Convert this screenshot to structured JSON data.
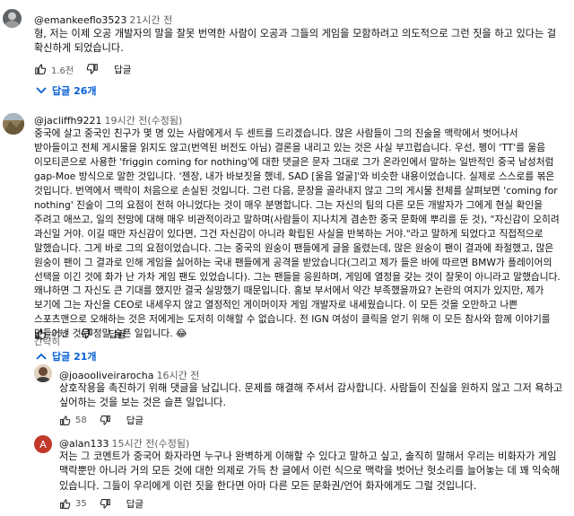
{
  "comments": [
    {
      "handle": "@emankeeflo3523",
      "time": "21시간 전",
      "text": "형, 저는 이제 오공 개발자의 말을 잘못 번역한 사람이 오공과 그들의 게임을 모함하려고 의도적으로 그런 짓을 하고 있다는 걸 확신하게 되었습니다.",
      "likes": "1.6천",
      "reply_label": "답글",
      "replies_label": "답글 26개"
    },
    {
      "handle": "@jacliffh9221",
      "time": "19시간 전(수정됨)",
      "text": "중국에 살고 중국인 친구가 몇 명 있는 사람에게서 두 센트를 드리겠습니다. 많은 사람들이 그의 진술을 맥락에서 벗어나서 받아들이고 전체 게시물을 읽지도 않고(번역된 버전도 아님) 결론을 내리고 있는 것은 사실 부끄럽습니다. 우선, 펭이 'TT'를 울음 이모티콘으로 사용한 'friggin coming for nothing'에 대한 댓글은 문자 그대로 그가 온라인에서 말하는 일반적인 중국 남성처럼 gap-Moe 방식으로 말한 것입니다. '젠장, 내가 바보짓을 했네, SAD [울음 얼굴]'와 비슷한 내용이었습니다. 실제로 스스로를 볶은 것입니다. 번역에서 맥락이 처음으로 손실된 것입니다. 그런 다음, 문장을 골라내지 않고 그의 게시물 전체를 살펴보면 'coming for nothing' 진술이 그의 요점이 전혀 아니었다는 것이 매우 분명합니다. 그는 자신의 팀의 다른 모든 개발자가 그에게 현실 확인을 주려고 애쓰고, 일의 전망에 대해 매우 비관적이라고 말하며(사람들이 지나치게 겸손한 중국 문화에 뿌리를 둔 것), \"자신감이 오히려 과신일 거야. 이길 때만 자신감이 있다면, 그건 자신감이 아니라 확립된 사실을 반복하는 거야.\"라고 말하게 되었다고 직접적으로 말했습니다. 그게 바로 그의 요점이었습니다. 그는 중국의 원숭이 팬들에게 글을 올렸는데, 많은 원숭이 팬이 결과에 좌절했고, 많은 원숭이 팬이 그 결과로 인해 게임을 싫어하는 국내 팬들에게 공격을 받았습니다(그리고 제가 들은 바에 따르면 BMW가 플레이어의 선택을 이긴 것에 화가 난 가차 게임 팬도 있었습니다). 그는 팬들을 응원하며, 게임에 열정을 갖는 것이 잘못이 아니라고 말했습니다. 왜냐하면 그 자신도 큰 기대를 했지만 결국 실망했기 때문입니다. 홍보 부서에서 약간 부족했을까요? 논란의 여지가 있지만, 제가 보기에 그는 자신을 CEO로 내세우지 않고 열정적인 게이머이자 게임 개발자로 내세웠습니다. 이 모든 것을 오만하고 나쁜 스포츠맨으로 오해하는 것은 저에게는 도저히 이해할 수 없습니다. 전 IGN 여성이 클릭을 얻기 위해 이 모든 참사와 함께 이야기를 만들어낸 것은 정말 슬픈 일입니다. 😂",
      "translate_label": "간략히",
      "likes": "855",
      "reply_label": "답글",
      "replies_label": "답글 21개"
    },
    {
      "handle": "@joaooliveirarocha",
      "time": "16시간 전",
      "text": "상호작용을 촉진하기 위해 댓글을 남깁니다. 문제를 해결해 주셔서 감사합니다. 사람들이 진실을 원하지 않고 그저 욕하고 싶어하는 것을 보는 것은 슬픈 일입니다.",
      "likes": "58",
      "reply_label": "답글"
    },
    {
      "handle": "@alan133",
      "time": "15시간 전(수정됨)",
      "avatar_letter": "A",
      "text": "저는 그 코멘트가 중국어 화자라면 누구나 완벽하게 이해할 수 있다고 말하고 싶고, 솔직히 말해서 우리는 비화자가 게임 맥락뿐만 아니라 거의 모든 것에 대한 의제로 가득 찬 글에서 이런 식으로 맥락을 벗어난 헛소리를 늘어놓는 데 꽤 익숙해 있습니다. 그들이 우리에게 이런 짓을 한다면 아마 다른 모든 문화권/언어 화자에게도 그럴 것입니다.",
      "likes": "35",
      "reply_label": "답글"
    }
  ],
  "colors": {
    "link_blue": "#065fd4",
    "meta_gray": "#606060",
    "alan_avatar": "#c0392b"
  }
}
